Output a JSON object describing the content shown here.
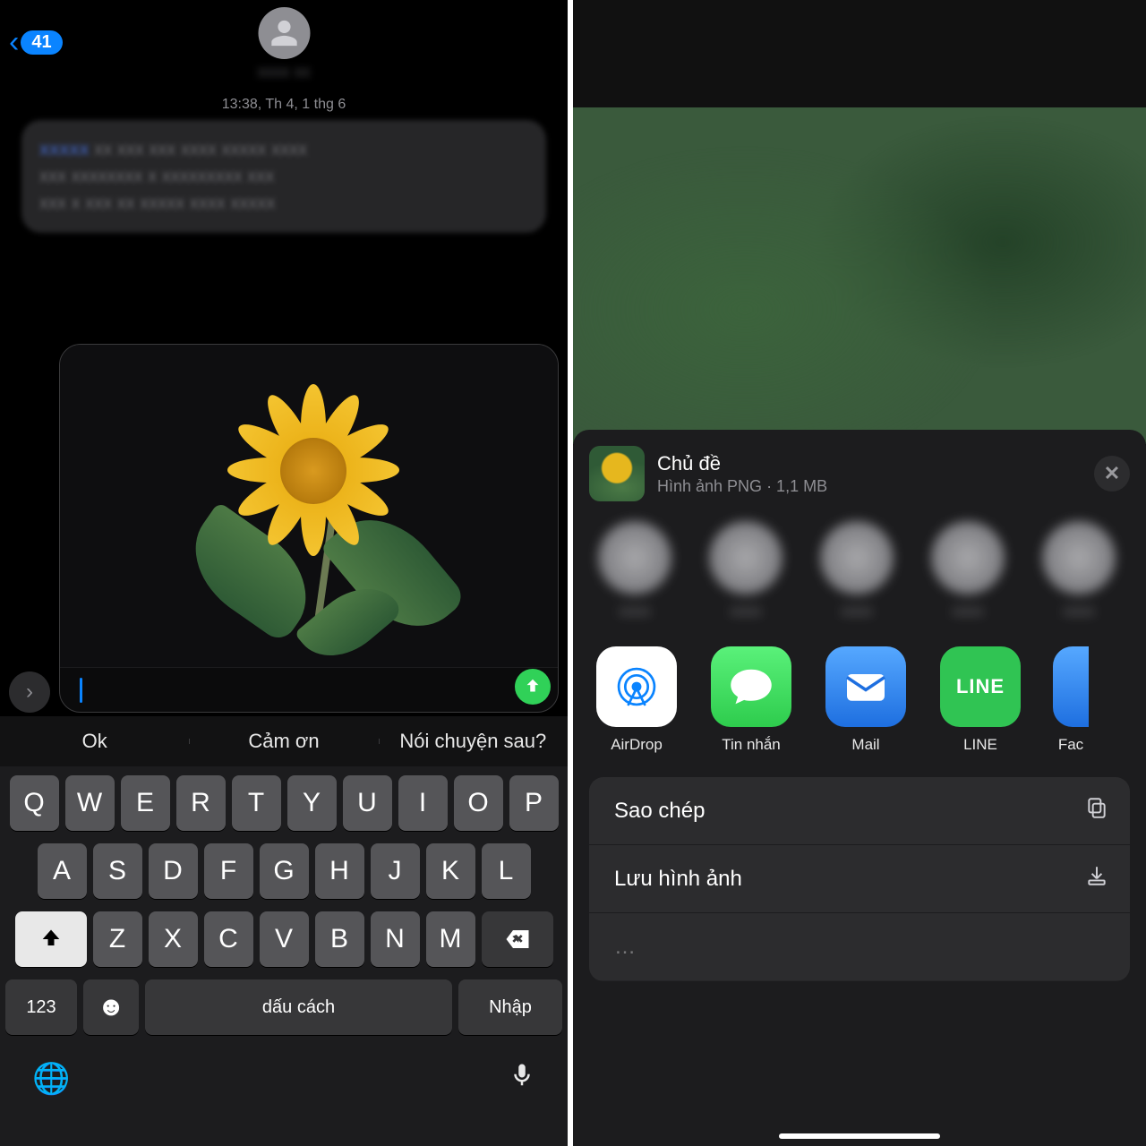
{
  "left": {
    "back_count": "41",
    "contact_name_redacted": "xxxx xx",
    "timestamp": "13:38, Th 4, 1 thg 6",
    "bubble_redacted": {
      "prefix": "xxxxx",
      "line1": "xx xxx xxx xxxx xxxxx xxxx",
      "line2": "xxx xxxxxxxx x xxxxxxxxx xxx",
      "line3": "xxx x xxx xx xxxxx xxxx xxxxx"
    },
    "suggestions": [
      "Ok",
      "Cảm ơn",
      "Nói chuyện sau?"
    ],
    "keyboard": {
      "row1": [
        "Q",
        "W",
        "E",
        "R",
        "T",
        "Y",
        "U",
        "I",
        "O",
        "P"
      ],
      "row2": [
        "A",
        "S",
        "D",
        "F",
        "G",
        "H",
        "J",
        "K",
        "L"
      ],
      "row3": [
        "Z",
        "X",
        "C",
        "V",
        "B",
        "N",
        "M"
      ],
      "k123": "123",
      "space": "dấu cách",
      "return": "Nhập"
    }
  },
  "right": {
    "subject_title": "Chủ đề",
    "subject_sub": "Hình ảnh PNG · 1,1 MB",
    "apps": [
      {
        "name": "AirDrop"
      },
      {
        "name": "Tin nhắn"
      },
      {
        "name": "Mail"
      },
      {
        "name": "LINE"
      },
      {
        "name": "Fac"
      }
    ],
    "actions": [
      {
        "label": "Sao chép",
        "icon": "copy"
      },
      {
        "label": "Lưu hình ảnh",
        "icon": "download"
      }
    ]
  }
}
